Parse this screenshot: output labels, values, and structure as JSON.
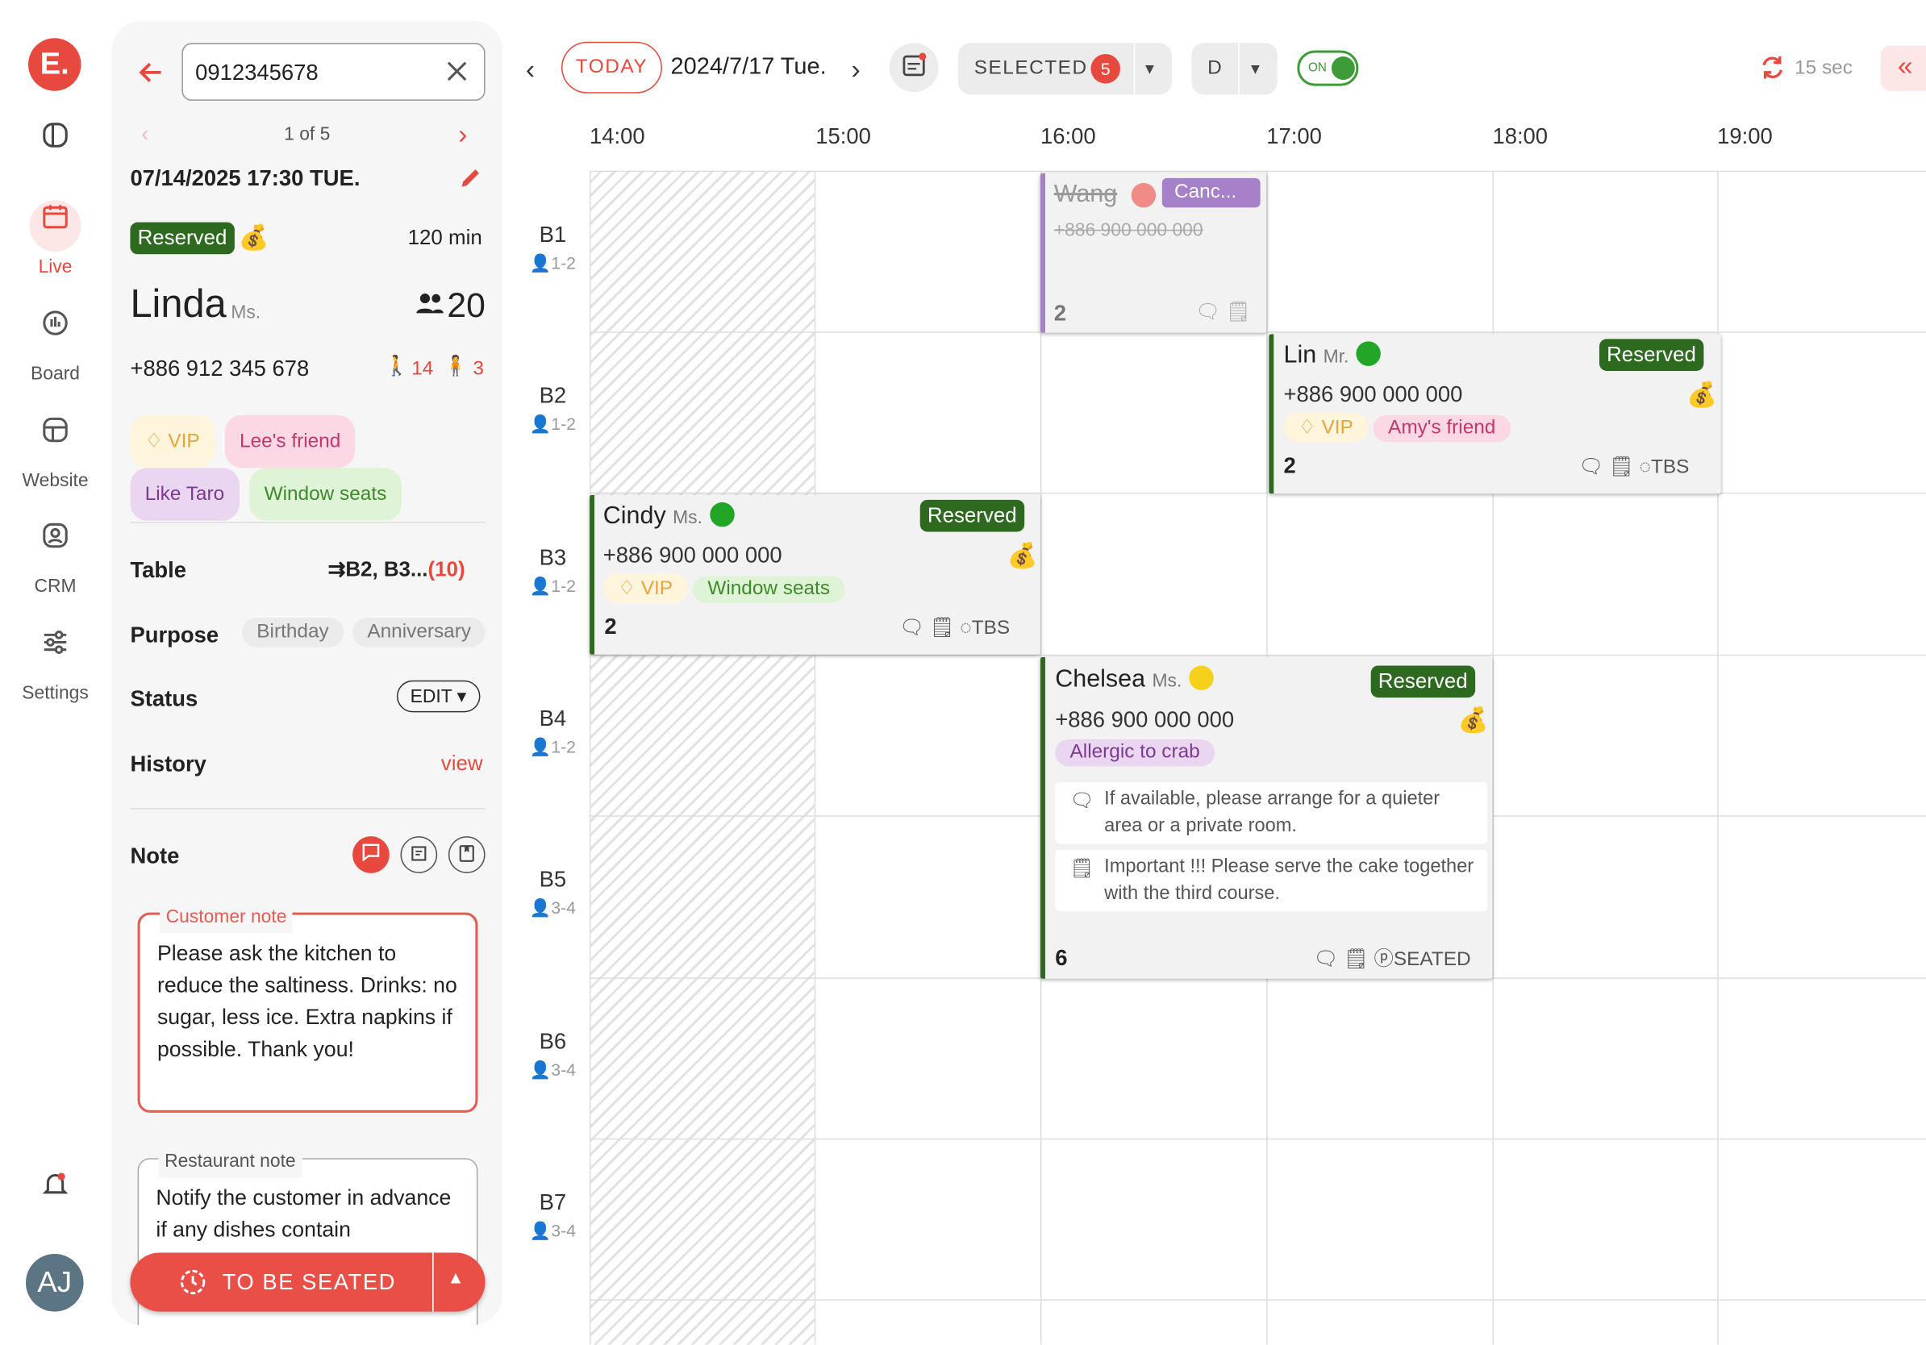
{
  "nav": {
    "logo": "E.",
    "items": [
      {
        "label": ""
      },
      {
        "label": "Live"
      },
      {
        "label": "Board"
      },
      {
        "label": "Website"
      },
      {
        "label": "CRM"
      },
      {
        "label": "Settings"
      }
    ],
    "avatar": "AJ"
  },
  "panel": {
    "search_value": "0912345678",
    "pager": "1 of 5",
    "datetime": "07/14/2025 17:30 TUE.",
    "status_tag": "Reserved",
    "duration": "120 min",
    "guest_name": "Linda",
    "guest_title": "Ms.",
    "party_size": "20",
    "phone": "+886 912 345 678",
    "adults": "14",
    "children": "3",
    "tags": [
      "VIP",
      "Lee's friend",
      "Like Taro",
      "Window seats"
    ],
    "table_label": "Table",
    "table_value": "B2, B3...",
    "table_count": "(10)",
    "purpose_label": "Purpose",
    "purpose_options": [
      "Birthday",
      "Anniversary"
    ],
    "status_label": "Status",
    "status_edit": "EDIT",
    "history_label": "History",
    "history_link": "view",
    "note_label": "Note",
    "customer_note_legend": "Customer note",
    "customer_note": "Please ask the kitchen to reduce the saltiness. Drinks: no sugar, less ice. Extra napkins if possible. Thank you!",
    "restaurant_note_legend": "Restaurant note",
    "restaurant_note": "Notify the customer in advance if any dishes contain",
    "seat_button": "TO BE SEATED"
  },
  "topbar": {
    "today": "TODAY",
    "date": "2024/7/17 Tue.",
    "selected_label": "SELECTED",
    "selected_count": "5",
    "view_mode": "D",
    "toggle_label": "ON",
    "refresh": "15 sec"
  },
  "timeline": {
    "hours": [
      "14:00",
      "15:00",
      "16:00",
      "17:00",
      "18:00",
      "19:00"
    ],
    "tables": [
      {
        "name": "B1",
        "cap": "1-2"
      },
      {
        "name": "B2",
        "cap": "1-2"
      },
      {
        "name": "B3",
        "cap": "1-2"
      },
      {
        "name": "B4",
        "cap": "1-2"
      },
      {
        "name": "B5",
        "cap": "3-4"
      },
      {
        "name": "B6",
        "cap": "3-4"
      },
      {
        "name": "B7",
        "cap": "3-4"
      }
    ]
  },
  "bookings": {
    "wang": {
      "name": "Wang",
      "status": "Canc...",
      "phone": "+886 900 000 000",
      "count": "2"
    },
    "lin": {
      "name": "Lin",
      "title": "Mr.",
      "status": "Reserved",
      "phone": "+886 900 000 000",
      "tags": [
        "VIP",
        "Amy's friend"
      ],
      "count": "2",
      "state": "TBS"
    },
    "cindy": {
      "name": "Cindy",
      "title": "Ms.",
      "status": "Reserved",
      "phone": "+886 900 000 000",
      "tags": [
        "VIP",
        "Window seats"
      ],
      "count": "2",
      "state": "TBS"
    },
    "chelsea": {
      "name": "Chelsea",
      "title": "Ms.",
      "status": "Reserved",
      "phone": "+886 900 000 000",
      "tags": [
        "Allergic to crab"
      ],
      "note1": "If available, please arrange for a quieter area or a private room.",
      "note2": "Important !!! Please serve the cake together with the third course.",
      "count": "6",
      "state": "SEATED"
    }
  },
  "colors": {
    "accent": "#e8493f",
    "reserved": "#2d6a1f",
    "cancelled": "#a681c9"
  }
}
